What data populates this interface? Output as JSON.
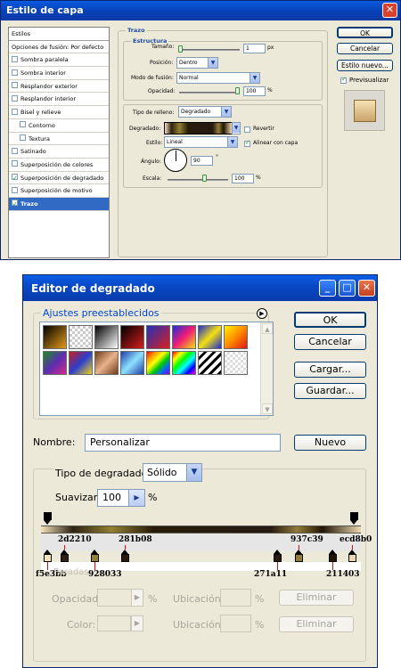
{
  "layer_style": {
    "title": "Estilo de capa",
    "close_glyph": "✕",
    "styles_header": "Estilos",
    "style_items": [
      {
        "label": "Opciones de fusión: Por defecto",
        "checkbox": false,
        "checked": false,
        "indent": false,
        "active": false
      },
      {
        "label": "Sombra paralela",
        "checkbox": true,
        "checked": false,
        "indent": false,
        "active": false
      },
      {
        "label": "Sombra interior",
        "checkbox": true,
        "checked": false,
        "indent": false,
        "active": false
      },
      {
        "label": "Resplandor exterior",
        "checkbox": true,
        "checked": false,
        "indent": false,
        "active": false
      },
      {
        "label": "Resplandor interior",
        "checkbox": true,
        "checked": false,
        "indent": false,
        "active": false
      },
      {
        "label": "Bisel y relieve",
        "checkbox": true,
        "checked": false,
        "indent": false,
        "active": false
      },
      {
        "label": "Contorno",
        "checkbox": true,
        "checked": false,
        "indent": true,
        "active": false
      },
      {
        "label": "Textura",
        "checkbox": true,
        "checked": false,
        "indent": true,
        "active": false
      },
      {
        "label": "Satinado",
        "checkbox": true,
        "checked": false,
        "indent": false,
        "active": false
      },
      {
        "label": "Superposición de colores",
        "checkbox": true,
        "checked": false,
        "indent": false,
        "active": false
      },
      {
        "label": "Superposición de degradado",
        "checkbox": true,
        "checked": true,
        "indent": false,
        "active": false
      },
      {
        "label": "Superposición de motivo",
        "checkbox": true,
        "checked": false,
        "indent": false,
        "active": false
      },
      {
        "label": "Trazo",
        "checkbox": true,
        "checked": true,
        "indent": false,
        "active": true
      }
    ],
    "trazo_title": "Trazo",
    "estructura_title": "Estructura",
    "size_label": "Tamaño:",
    "size_value": "1",
    "size_unit": "px",
    "position_label": "Posición:",
    "position_value": "Dentro",
    "blend_label": "Modo de fusión:",
    "blend_value": "Normal",
    "opacity_label": "Opacidad:",
    "opacity_value": "100",
    "opacity_unit": "%",
    "fill_type_label": "Tipo de relleno:",
    "fill_type_value": "Degradado",
    "gradient_label": "Degradado:",
    "reverse_label": "Revertir",
    "style_label": "Estilo:",
    "style_value": "Lineal",
    "align_label": "Alinear con capa",
    "angle_label": "Ángulo:",
    "angle_value": "90",
    "angle_unit": "°",
    "scale_label": "Escala:",
    "scale_value": "100",
    "scale_unit": "%",
    "ok_label": "OK",
    "cancel_label": "Cancelar",
    "new_style_label": "Estilo nuevo...",
    "preview_label": "Previsualizar"
  },
  "gradient_editor": {
    "title": "Editor de degradado",
    "min_glyph": "_",
    "max_glyph": "□",
    "close_glyph": "✕",
    "presets_label": "Ajustes preestablecidos",
    "ok_label": "OK",
    "cancel_label": "Cancelar",
    "load_label": "Cargar...",
    "save_label": "Guardar...",
    "name_label": "Nombre:",
    "name_value": "Personalizar",
    "new_label": "Nuevo",
    "type_label": "Tipo de degradado:",
    "type_value": "Sólido",
    "smooth_label": "Suavizar:",
    "smooth_value": "100",
    "smooth_unit": "%",
    "paradas_label": "Paradas",
    "opacity_label": "Opacidad:",
    "location_label": "Ubicación:",
    "color_label": "Color:",
    "pct": "%",
    "delete_label": "Eliminar",
    "stop_labels": [
      "f5e3bb",
      "2d2210",
      "928033",
      "281b08",
      "271a11",
      "937c39",
      "211403",
      "ecd8b0"
    ],
    "stop_colors": [
      "#f5e3bb",
      "#2d2210",
      "#928033",
      "#281b08",
      "#271a11",
      "#937c39",
      "#211403",
      "#ecd8b0"
    ]
  }
}
